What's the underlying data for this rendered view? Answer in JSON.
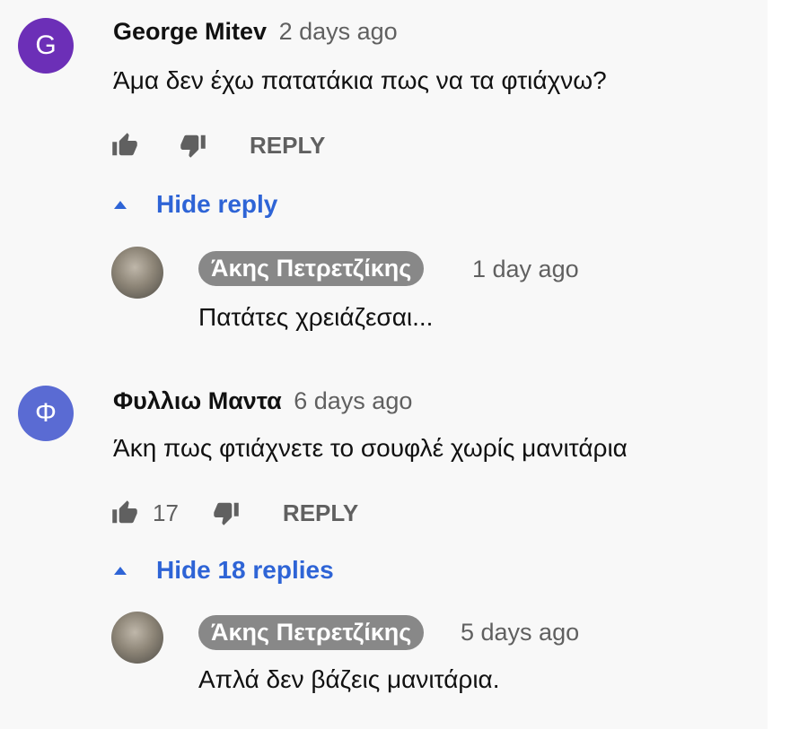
{
  "comments": [
    {
      "avatar_letter": "G",
      "avatar_color": "#6c2fb7",
      "author": "George Mitev",
      "time": "2 days ago",
      "text": "Άμα δεν έχω πατατάκια πως να τα φτιάχνω?",
      "likes": "",
      "reply_label": "REPLY",
      "toggle_label": "Hide reply",
      "reply": {
        "author": "Άκης Πετρετζίκης",
        "time": "1 day ago",
        "text": "Πατάτες χρειάζεσαι..."
      }
    },
    {
      "avatar_letter": "Φ",
      "avatar_color": "#5a6bd3",
      "author": "Φυλλιω Μαντα",
      "time": "6 days ago",
      "text": "Άκη πως φτιάχνετε το σουφλέ χωρίς μανιτάρια",
      "likes": "17",
      "reply_label": "REPLY",
      "toggle_label": "Hide 18 replies",
      "reply": {
        "author": "Άκης Πετρετζίκης",
        "time": "5 days ago",
        "text": "Απλά δεν βάζεις μανιτάρια."
      }
    }
  ],
  "colors": {
    "link_blue": "#2e64d6",
    "meta_gray": "#606060",
    "creator_chip": "#888888"
  },
  "icons": [
    "thumbs-up-icon",
    "thumbs-down-icon",
    "caret-up-icon"
  ]
}
